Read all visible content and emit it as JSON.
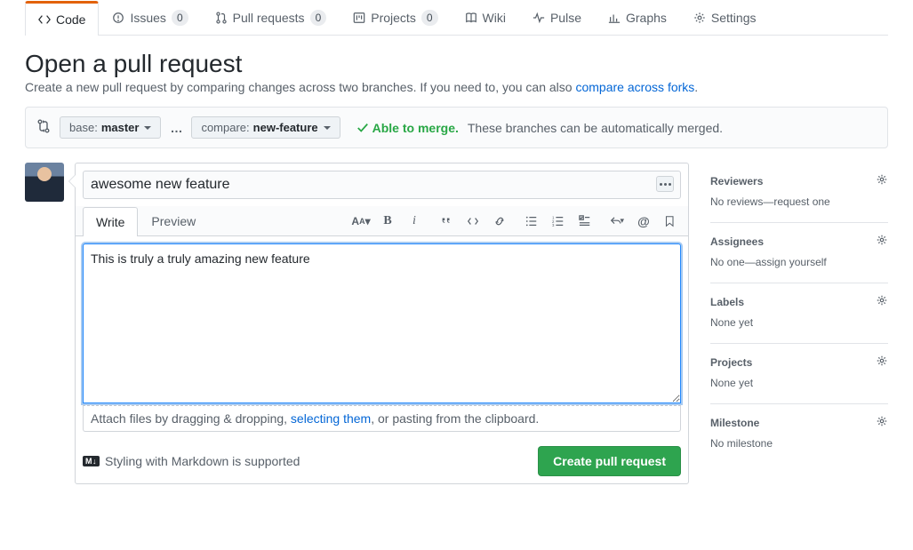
{
  "tabs": {
    "code": "Code",
    "issues": "Issues",
    "issues_count": "0",
    "pr": "Pull requests",
    "pr_count": "0",
    "projects": "Projects",
    "projects_count": "0",
    "wiki": "Wiki",
    "pulse": "Pulse",
    "graphs": "Graphs",
    "settings": "Settings"
  },
  "page": {
    "title": "Open a pull request",
    "subtitle_pre": "Create a new pull request by comparing changes across two branches. If you need to, you can also ",
    "subtitle_link": "compare across forks",
    "subtitle_post": "."
  },
  "range": {
    "base_label": "base:",
    "base_value": "master",
    "compare_label": "compare:",
    "compare_value": "new-feature",
    "able": "Able to merge.",
    "note": "These branches can be automatically merged."
  },
  "composer": {
    "title_value": "awesome new feature",
    "write_tab": "Write",
    "preview_tab": "Preview",
    "body_value": "This is truly a truly amazing new feature",
    "attach_pre": "Attach files by dragging & dropping, ",
    "attach_link": "selecting them",
    "attach_post": ", or pasting from the clipboard.",
    "md_badge": "M↓",
    "md_hint": "Styling with Markdown is supported",
    "submit": "Create pull request"
  },
  "sidebar": {
    "reviewers_h": "Reviewers",
    "reviewers_v": "No reviews—request one",
    "assignees_h": "Assignees",
    "assignees_pre": "No one—",
    "assignees_link": "assign yourself",
    "labels_h": "Labels",
    "labels_v": "None yet",
    "projects_h": "Projects",
    "projects_v": "None yet",
    "milestone_h": "Milestone",
    "milestone_v": "No milestone"
  }
}
